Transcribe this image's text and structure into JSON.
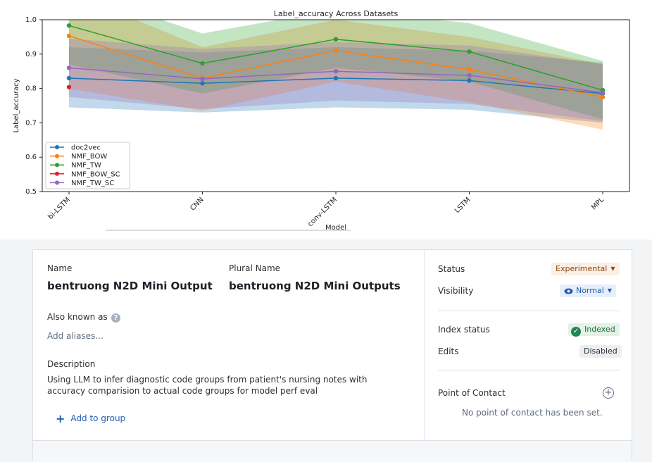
{
  "chart_data": {
    "type": "line",
    "title": "Label_accuracy Across Datasets",
    "xlabel": "Model",
    "ylabel": "Label_accuracy",
    "categories": [
      "bi-LSTM",
      "CNN",
      "conv-LSTM",
      "LSTM",
      "MPL"
    ],
    "ylim": [
      0.5,
      1.0
    ],
    "yticks": [
      "0.5",
      "0.6",
      "0.7",
      "0.8",
      "0.9",
      "1.0"
    ],
    "grid": false,
    "legend_position": "lower-left",
    "series": [
      {
        "name": "doc2vec",
        "color": "#1f77b4",
        "values": [
          0.83,
          0.815,
          0.83,
          0.823,
          0.785
        ],
        "band_low": [
          0.745,
          0.73,
          0.745,
          0.738,
          0.7
        ],
        "band_high": [
          0.92,
          0.905,
          0.92,
          0.91,
          0.875
        ]
      },
      {
        "name": "NMF_BOW",
        "color": "#ff7f0e",
        "values": [
          0.953,
          0.83,
          0.91,
          0.855,
          0.775
        ],
        "band_low": [
          0.8,
          0.735,
          0.82,
          0.76,
          0.68
        ],
        "band_high": [
          1.08,
          0.92,
          1.0,
          0.95,
          0.87
        ]
      },
      {
        "name": "NMF_TW",
        "color": "#2ca02c",
        "values": [
          0.983,
          0.873,
          0.943,
          0.907,
          0.795
        ],
        "band_low": [
          0.87,
          0.785,
          0.86,
          0.82,
          0.71
        ],
        "band_high": [
          1.09,
          0.96,
          1.03,
          0.99,
          0.88
        ]
      },
      {
        "name": "NMF_BOW_SC",
        "color": "#d62728",
        "values": [
          0.804,
          null,
          null,
          null,
          null
        ],
        "band_low": [],
        "band_high": []
      },
      {
        "name": "NMF_TW_SC",
        "color": "#9467bd",
        "values": [
          0.86,
          0.828,
          0.85,
          0.838,
          0.788
        ],
        "band_low": [
          0.775,
          0.74,
          0.765,
          0.755,
          0.705
        ],
        "band_high": [
          0.945,
          0.915,
          0.935,
          0.925,
          0.87
        ]
      }
    ]
  },
  "card": {
    "name_label": "Name",
    "name_value": "bentruong N2D Mini Output",
    "plural_label": "Plural Name",
    "plural_value": "bentruong N2D Mini Outputs",
    "aka_label": "Also known as",
    "aka_help_icon": "?",
    "aliases_placeholder": "Add aliases...",
    "description_label": "Description",
    "description_text": "Using LLM to infer diagnostic code groups from patient's nursing notes with accuracy comparision to actual code groups for model perf eval",
    "add_group_label": "Add to group",
    "status_label": "Status",
    "status_value": "Experimental",
    "visibility_label": "Visibility",
    "visibility_value": "Normal",
    "index_status_label": "Index status",
    "index_status_value": "Indexed",
    "edits_label": "Edits",
    "edits_value": "Disabled",
    "poc_label": "Point of Contact",
    "poc_empty": "No point of contact has been set."
  },
  "colors": {
    "status_accent": "#8a4b12",
    "visibility_accent": "#215db0",
    "indexed_accent": "#238551",
    "link": "#215db0"
  }
}
